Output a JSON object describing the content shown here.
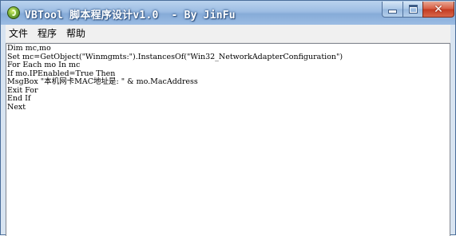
{
  "window": {
    "title": "VBTool 脚本程序设计v1.0  - By JinFu",
    "close_symbol": "✕"
  },
  "menu": {
    "items": [
      "文件",
      "程序",
      "帮助"
    ]
  },
  "editor": {
    "lines": [
      "Dim mc,mo",
      "Set mc=GetObject(\"Winmgmts:\").InstancesOf(\"Win32_NetworkAdapterConfiguration\")",
      "For Each mo In mc",
      "If mo.IPEnabled=True Then",
      "MsgBox \"本机网卡MAC地址是: \" & mo.MacAddress",
      "Exit For",
      "End If",
      "Next"
    ]
  }
}
